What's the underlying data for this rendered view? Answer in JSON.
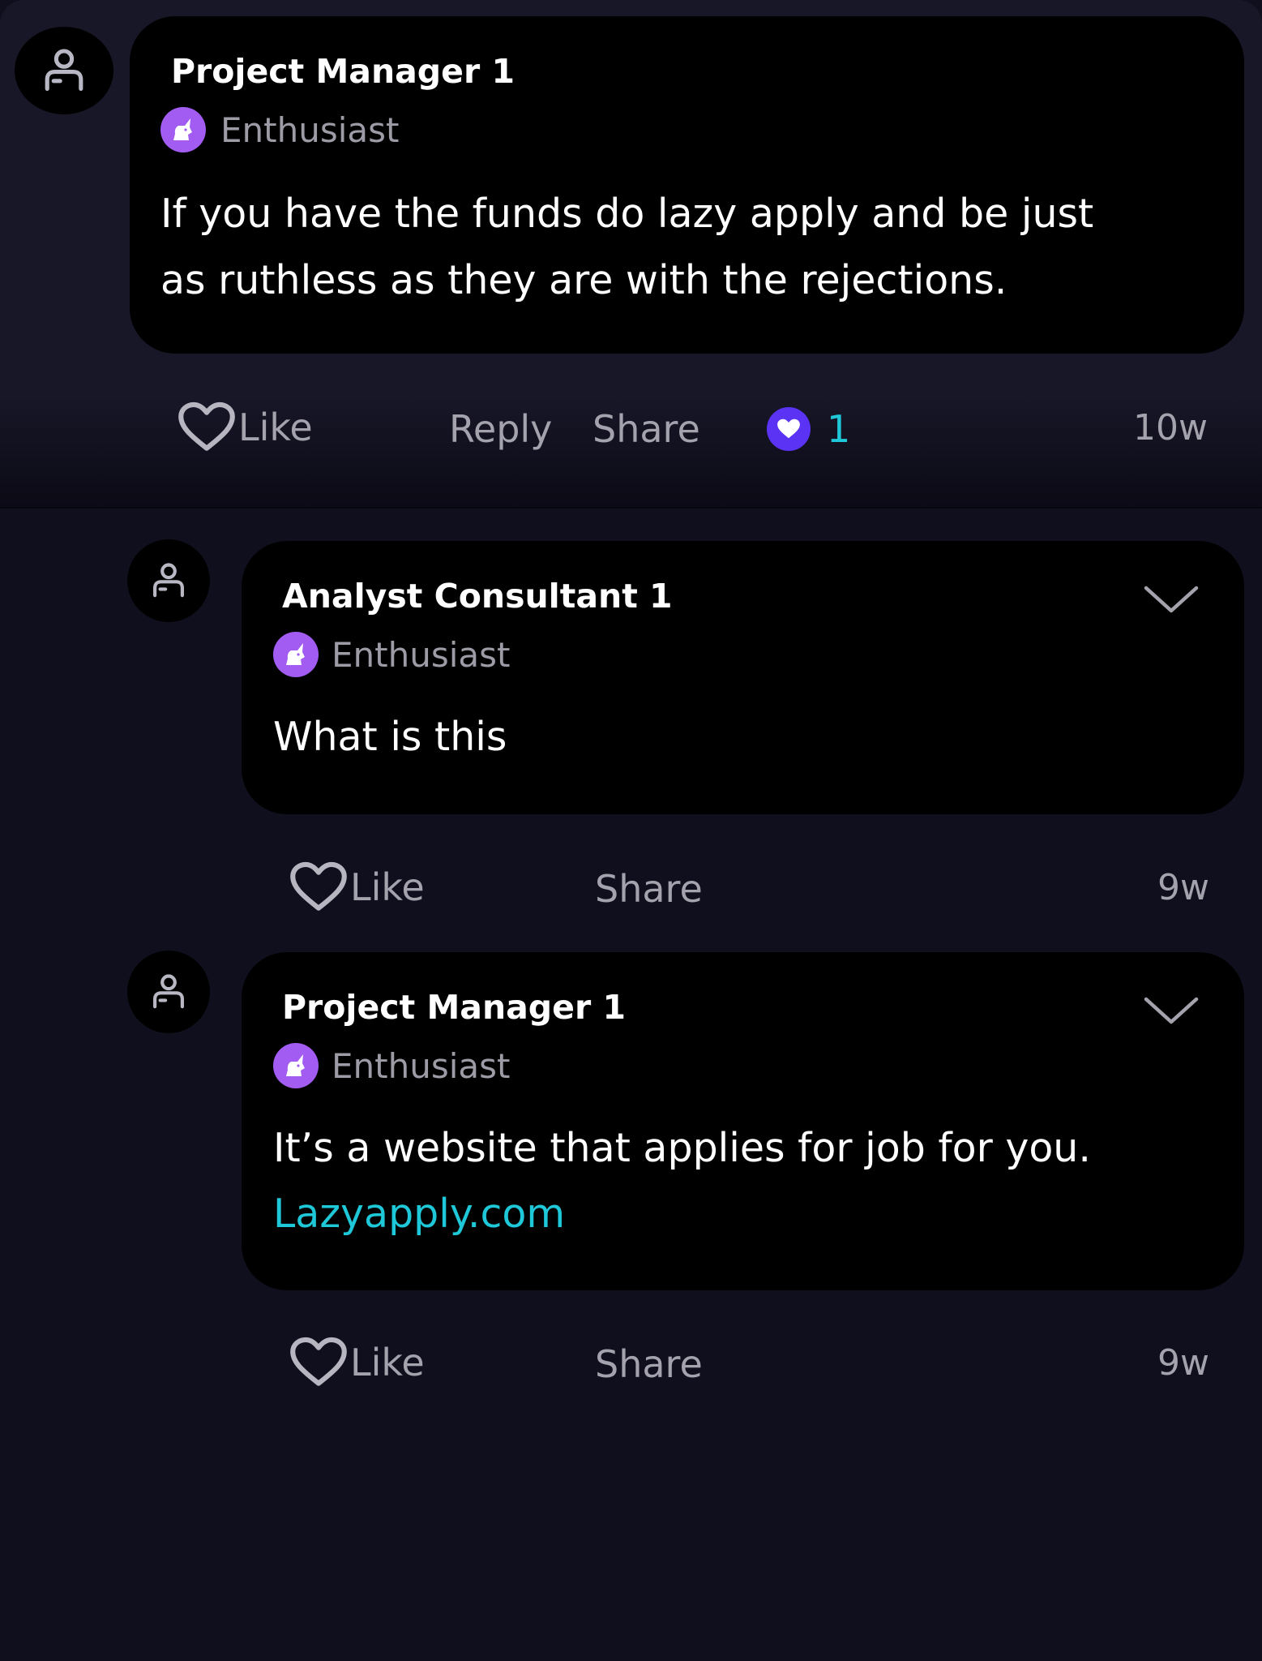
{
  "colors": {
    "background": "#100f1e",
    "top_post_background": "#181728",
    "bubble": "#000000",
    "badge": "#a25cf2",
    "reaction_heart": "#5a33f5",
    "link": "#1fc8d8",
    "muted_text": "#a3a2ad"
  },
  "post": {
    "author": "Project Manager 1",
    "badge_label": "Enthusiast",
    "badge_icon": "unicorn-icon",
    "text_line1": "If you have the funds do lazy apply and be just",
    "text_line2": "as ruthless as they are with the rejections.",
    "actions": {
      "like": "Like",
      "reply": "Reply",
      "share": "Share"
    },
    "reaction_count": "1",
    "time": "10w"
  },
  "replies": [
    {
      "author": "Analyst Consultant 1",
      "badge_label": "Enthusiast",
      "badge_icon": "unicorn-icon",
      "text_line1": "What is this",
      "actions": {
        "like": "Like",
        "share": "Share"
      },
      "time": "9w"
    },
    {
      "author": "Project Manager 1",
      "badge_label": "Enthusiast",
      "badge_icon": "unicorn-icon",
      "text_line1": "It’s a website that applies for job for you.",
      "link": "Lazyapply.com",
      "actions": {
        "like": "Like",
        "share": "Share"
      },
      "time": "9w"
    }
  ]
}
